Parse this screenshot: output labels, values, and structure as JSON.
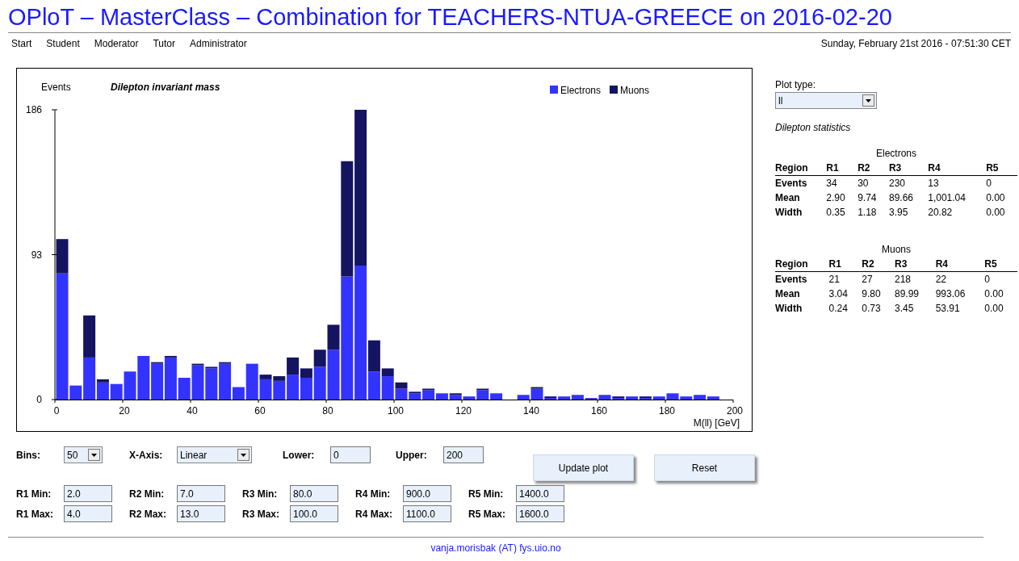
{
  "title": "OPloT – MasterClass – Combination for TEACHERS-NTUA-GREECE on 2016-02-20",
  "nav": [
    "Start",
    "Student",
    "Moderator",
    "Tutor",
    "Administrator"
  ],
  "datetime": "Sunday, February 21st 2016 - 07:51:30 CET",
  "plot": {
    "chart_data": {
      "type": "bar",
      "title": "Dilepton invariant mass",
      "xlabel": "M(ll) [GeV]",
      "ylabel": "Events",
      "stacked": true,
      "x": [
        2,
        6,
        10,
        14,
        18,
        22,
        26,
        30,
        34,
        38,
        42,
        46,
        50,
        54,
        58,
        62,
        66,
        70,
        74,
        78,
        82,
        86,
        90,
        94,
        98,
        102,
        106,
        110,
        114,
        118,
        122,
        126,
        130,
        134,
        138,
        142,
        146,
        150,
        154,
        158,
        162,
        166,
        170,
        174,
        178,
        182,
        186,
        190,
        194,
        198
      ],
      "series": [
        {
          "name": "Electrons",
          "color": "#3333ff",
          "values": [
            81,
            9,
            27,
            11,
            10,
            18,
            28,
            23,
            27,
            14,
            22,
            20,
            23,
            8,
            23,
            13,
            12,
            16,
            14,
            21,
            32,
            79,
            86,
            18,
            15,
            7,
            4,
            6,
            4,
            3,
            2,
            6,
            4,
            0,
            3,
            7,
            1,
            2,
            3,
            1,
            3,
            1,
            2,
            1,
            2,
            4,
            2,
            3,
            2,
            0
          ]
        },
        {
          "name": "Muons",
          "color": "#141460",
          "values": [
            22,
            0,
            27,
            2,
            0,
            0,
            0,
            1,
            1,
            0,
            1,
            1,
            1,
            0,
            0,
            3,
            3,
            11,
            6,
            11,
            16,
            74,
            100,
            20,
            5,
            4,
            1,
            1,
            0,
            1,
            0,
            1,
            0,
            0,
            0,
            1,
            1,
            0,
            0,
            0,
            0,
            1,
            0,
            1,
            0,
            0,
            0,
            0,
            0,
            0
          ]
        }
      ],
      "legend": "top right",
      "xlim": [
        0,
        200
      ],
      "ylim": [
        0,
        186
      ],
      "xticks": [
        0,
        20,
        40,
        60,
        80,
        100,
        120,
        140,
        160,
        180,
        200
      ],
      "yticks": [
        0,
        93,
        186
      ]
    }
  },
  "plot_type": {
    "label": "Plot type:",
    "value": "ll"
  },
  "statistics": {
    "title": "Dilepton statistics",
    "tables": [
      {
        "name": "Electrons",
        "columns": [
          "Region",
          "R1",
          "R2",
          "R3",
          "R4",
          "R5"
        ],
        "rows": [
          [
            "Events",
            "34",
            "30",
            "230",
            "13",
            "0"
          ],
          [
            "Mean",
            "2.90",
            "9.74",
            "89.66",
            "1,001.04",
            "0.00"
          ],
          [
            "Width",
            "0.35",
            "1.18",
            "3.95",
            "20.82",
            "0.00"
          ]
        ]
      },
      {
        "name": "Muons",
        "columns": [
          "Region",
          "R1",
          "R2",
          "R3",
          "R4",
          "R5"
        ],
        "rows": [
          [
            "Events",
            "21",
            "27",
            "218",
            "22",
            "0"
          ],
          [
            "Mean",
            "3.04",
            "9.80",
            "89.99",
            "993.06",
            "0.00"
          ],
          [
            "Width",
            "0.24",
            "0.73",
            "3.45",
            "53.91",
            "0.00"
          ]
        ]
      }
    ]
  },
  "controls": [
    {
      "kind": "select",
      "label": "Bins:",
      "value": "50"
    },
    {
      "kind": "select",
      "label": "X-Axis:",
      "value": "Linear"
    },
    {
      "kind": "input",
      "label": "Lower:",
      "value": "0"
    },
    {
      "kind": "input",
      "label": "Upper:",
      "value": "200"
    }
  ],
  "buttons": [
    "Update plot",
    "Reset"
  ],
  "regions": [
    {
      "min_label": "R1 Min:",
      "min": "2.0",
      "max_label": "R1 Max:",
      "max": "4.0"
    },
    {
      "min_label": "R2 Min:",
      "min": "7.0",
      "max_label": "R2 Max:",
      "max": "13.0"
    },
    {
      "min_label": "R3 Min:",
      "min": "80.0",
      "max_label": "R3 Max:",
      "max": "100.0"
    },
    {
      "min_label": "R4 Min:",
      "min": "900.0",
      "max_label": "R4 Max:",
      "max": "1100.0"
    },
    {
      "min_label": "R5 Min:",
      "min": "1400.0",
      "max_label": "R5 Max:",
      "max": "1600.0"
    }
  ],
  "footer": "vanja.morisbak (AT) fys.uio.no"
}
